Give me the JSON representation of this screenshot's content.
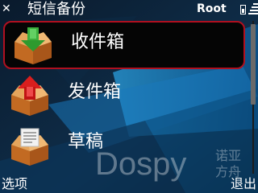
{
  "titlebar": {
    "close_icon": "close-icon",
    "title": "短信备份",
    "operator": "Root"
  },
  "menu": {
    "items": [
      {
        "label": "收件箱",
        "icon": "inbox-box-icon",
        "selected": true
      },
      {
        "label": "发件箱",
        "icon": "outbox-box-icon",
        "selected": false
      },
      {
        "label": "草稿",
        "icon": "drafts-box-icon",
        "selected": false
      }
    ]
  },
  "watermark": {
    "brand": "Dospy",
    "chinese": "诺亚方舟"
  },
  "softkeys": {
    "left": "选项",
    "right": "退出"
  },
  "colors": {
    "selection_border": "#b01020",
    "accent_blue": "#1e8fd0"
  }
}
